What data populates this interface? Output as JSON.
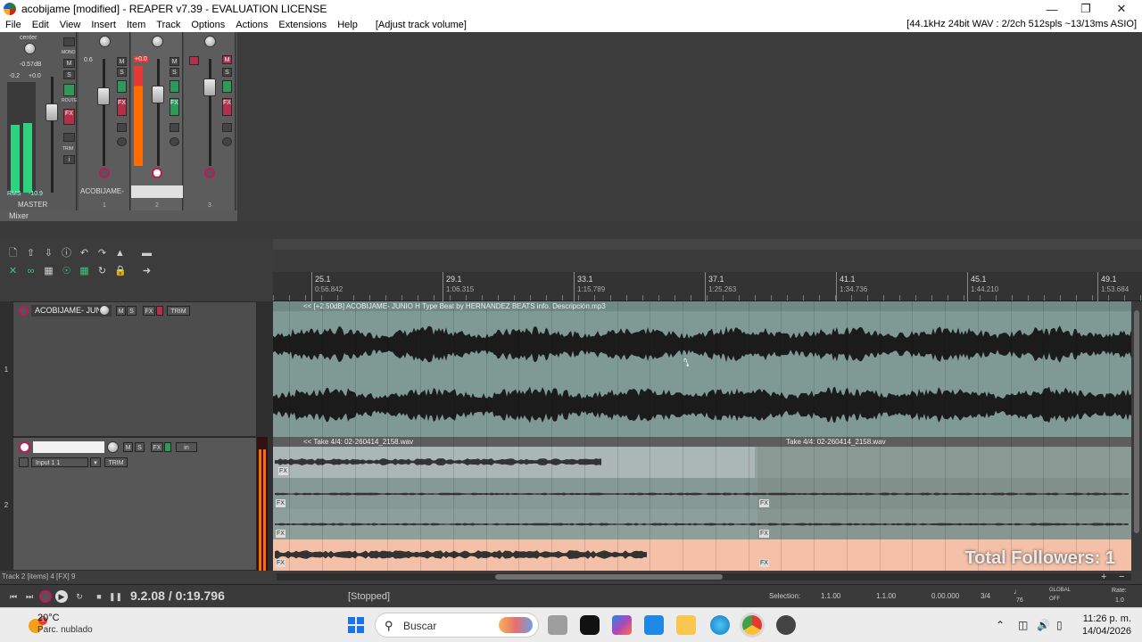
{
  "window": {
    "title": "acobijame [modified] - REAPER v7.39 - EVALUATION LICENSE",
    "controls": [
      "minimize",
      "maximize",
      "close"
    ]
  },
  "menu": {
    "items": [
      "File",
      "Edit",
      "View",
      "Insert",
      "Item",
      "Track",
      "Options",
      "Actions",
      "Extensions",
      "Help"
    ],
    "hint": "[Adjust track volume]",
    "audio_status": "[44.1kHz 24bit WAV : 2/2ch 512spls ~13/13ms ASIO]"
  },
  "mixer": {
    "tab_label": "Mixer",
    "master": {
      "label": "MASTER",
      "pan": "center",
      "volume": "-0.57dB",
      "peak_l": "-0.2",
      "peak_r": "+0.0",
      "rms_label": "RMS",
      "rms_value": "-10.9",
      "mono_label": "MONO",
      "route_label": "ROUTE",
      "trim_label": "TRIM"
    },
    "strips": [
      {
        "num": "1",
        "name": "ACOBIJAME-",
        "peak": "0.6"
      },
      {
        "num": "2",
        "name": "",
        "peak": "+0.0"
      },
      {
        "num": "3",
        "name": "",
        "peak": ""
      }
    ]
  },
  "ruler": {
    "marks": [
      {
        "bar": "25.1",
        "time": "0:56.842"
      },
      {
        "bar": "29.1",
        "time": "1:06.315"
      },
      {
        "bar": "33.1",
        "time": "1:15.789"
      },
      {
        "bar": "37.1",
        "time": "1:25.263"
      },
      {
        "bar": "41.1",
        "time": "1:34.736"
      },
      {
        "bar": "45.1",
        "time": "1:44.210"
      },
      {
        "bar": "49.1",
        "time": "1:53.684"
      }
    ]
  },
  "tracks": [
    {
      "num": "1",
      "name": "ACOBIJAME- JUNIO",
      "buttons": [
        "M",
        "S",
        "FX",
        "TRIM"
      ],
      "item_title": "<< [+2.50dB] ACOBIJAME- JUNIO H Type Beat by HERNANDEZ BEATS info. Descripción.mp3"
    },
    {
      "num": "2",
      "name": "",
      "input": "Input 1 1",
      "buttons": [
        "M",
        "S",
        "FX",
        "in",
        "TRIM"
      ],
      "items": [
        {
          "title": "<< Take 4/4: 02-260414_2158.wav"
        },
        {
          "title": "Take 4/4: 02-260414_2158.wav"
        }
      ],
      "fx_tag": "FX"
    }
  ],
  "overlay": {
    "followers": "Total Followers: 1"
  },
  "status_line": "Track 2 [items] 4 [FX] 9",
  "transport": {
    "position": "9.2.08 / 0:19.796",
    "state": "[Stopped]",
    "selection_label": "Selection:",
    "selection_start": "1.1.00",
    "selection_end": "1.1.00",
    "selection_length": "0.00.000",
    "time_sig": "3/4",
    "bpm": "76",
    "global_label": "GLOBAL",
    "global_state": "OFF",
    "rate_label": "Rate:",
    "rate_value": "1.0"
  },
  "taskbar": {
    "weather_temp": "20°C",
    "weather_desc": "Parc. nublado",
    "weather_badge": "1",
    "search_placeholder": "Buscar",
    "time": "11:26 p. m.",
    "date": "14/04/2026"
  },
  "colors": {
    "accent_green": "#2fd27e",
    "rec_red": "#c2185b",
    "track2_lane_highlight": "#f4c0a8"
  }
}
